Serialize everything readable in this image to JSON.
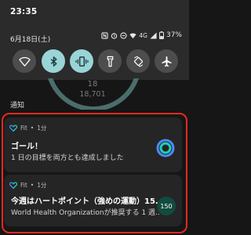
{
  "status_bar": {
    "time": "23:35",
    "date": "6月18日(土)",
    "network": "4G",
    "battery": "37%"
  },
  "quick_settings": {
    "tiles": [
      {
        "name": "wifi",
        "active": false
      },
      {
        "name": "bluetooth",
        "active": true
      },
      {
        "name": "vibrate",
        "active": true
      },
      {
        "name": "flashlight",
        "active": false
      },
      {
        "name": "auto-rotate",
        "active": false
      },
      {
        "name": "airplane-mode",
        "active": false
      }
    ]
  },
  "background": {
    "top_number": "18",
    "bottom_number": "18,701"
  },
  "section_label": "通知",
  "notifications": [
    {
      "app": "Fit",
      "time": "1分",
      "title": "ゴール！",
      "body": "1 日の目標を両方とも達成しました"
    },
    {
      "app": "Fit",
      "time": "1分",
      "title": "今週はハートポイント（強めの運動）15..",
      "body": "World Health Organizationが推奨する 1 週..",
      "badge": "150"
    }
  ],
  "colors": {
    "accent": "#9ad4d6",
    "highlight": "#e22a22",
    "fit_blue": "#4c8bf5",
    "fit_teal": "#1ccfbf"
  }
}
